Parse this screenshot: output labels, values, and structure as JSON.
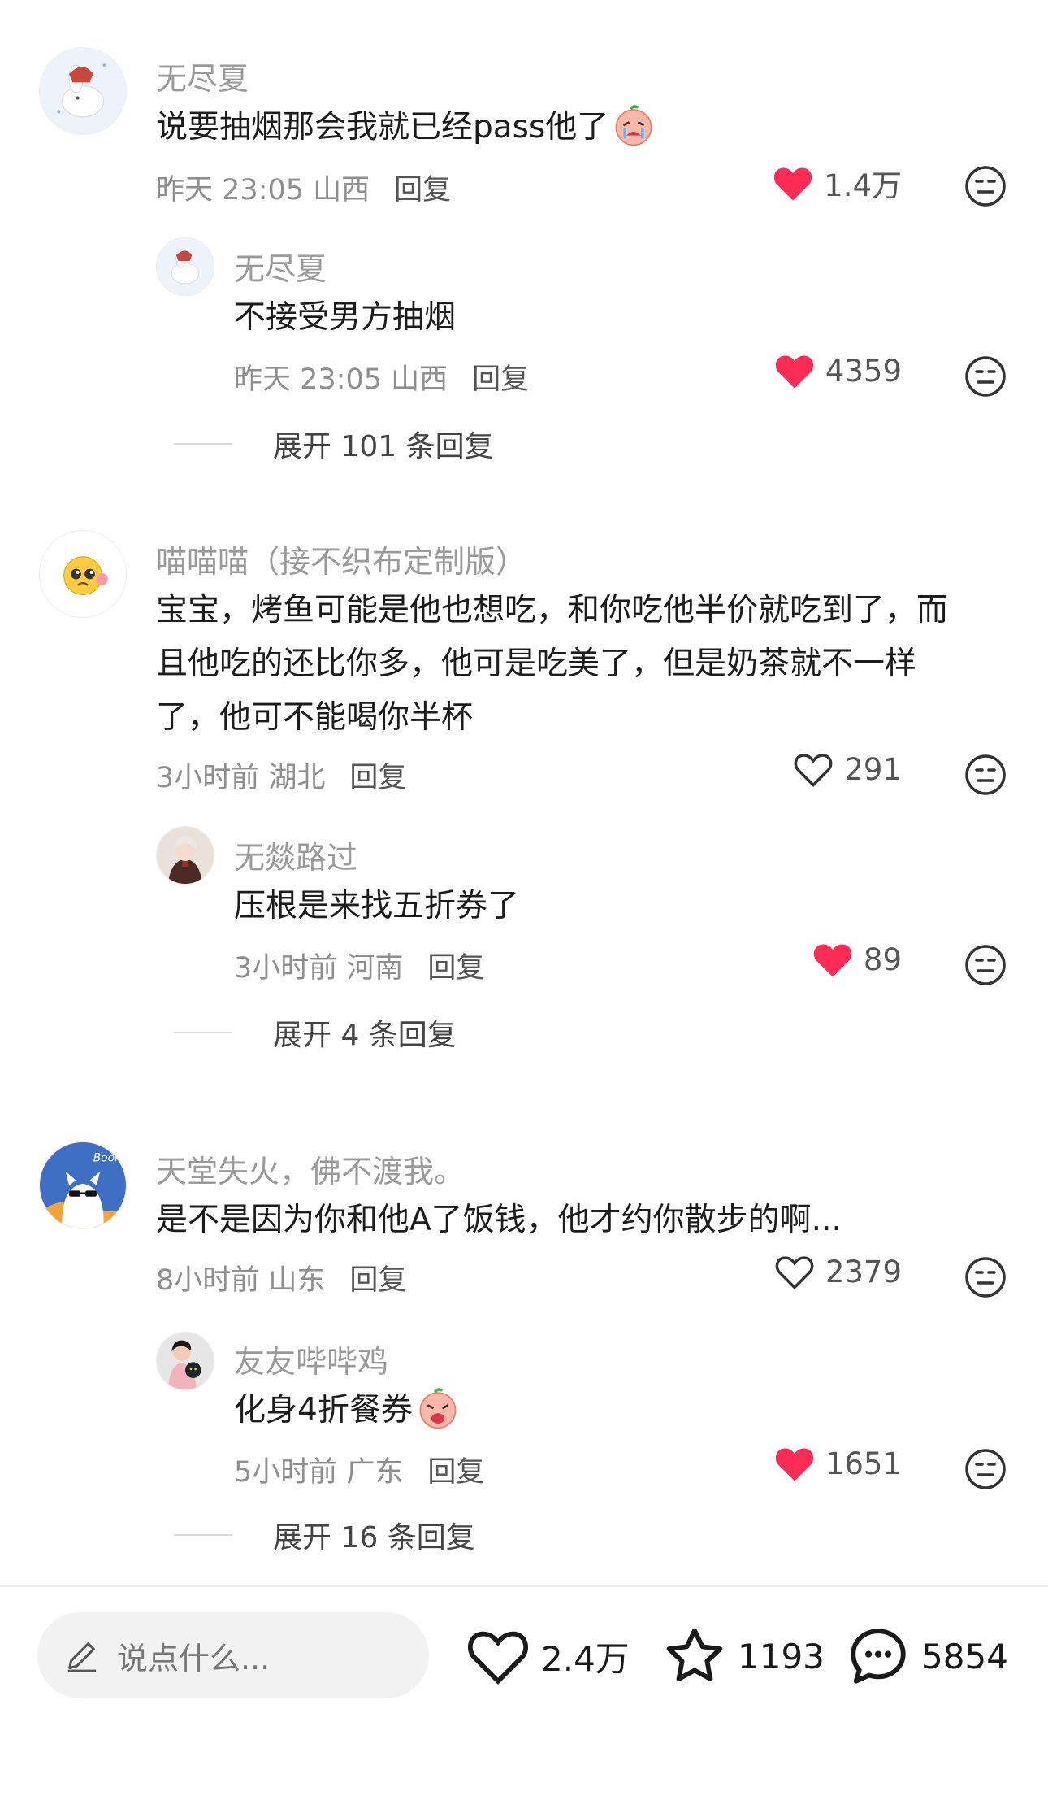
{
  "comments": [
    {
      "user": "无尽夏",
      "text": "说要抽烟那会我就已经pass他了",
      "time": "昨天 23:05 山西",
      "reply_label": "回复",
      "likes": "1.4万",
      "liked": true,
      "reply": {
        "user": "无尽夏",
        "text": "不接受男方抽烟",
        "time": "昨天 23:05 山西",
        "reply_label": "回复",
        "likes": "4359",
        "liked": true
      },
      "expand_label": "展开 101 条回复"
    },
    {
      "user": "喵喵喵（接不织布定制版）",
      "text_lines": [
        "宝宝，烤鱼可能是他也想吃，和你吃他半价就吃到了，而",
        "且他吃的还比你多，他可是吃美了，但是奶茶就不一样",
        "了，他可不能喝你半杯"
      ],
      "time": "3小时前 湖北",
      "reply_label": "回复",
      "likes": "291",
      "liked": false,
      "reply": {
        "user": "无燚路过",
        "text": "压根是来找五折券了",
        "time": "3小时前 河南",
        "reply_label": "回复",
        "likes": "89",
        "liked": true
      },
      "expand_label": "展开 4 条回复"
    },
    {
      "user": "天堂失火，佛不渡我。",
      "text": "是不是因为你和他A了饭钱，他才约你散步的啊...",
      "time": "8小时前 山东",
      "reply_label": "回复",
      "likes": "2379",
      "liked": false,
      "avatar_text": "Boom!",
      "reply": {
        "user": "友友哔哔鸡",
        "text": "化身4折餐券",
        "time": "5小时前 广东",
        "reply_label": "回复",
        "likes": "1651",
        "liked": true
      },
      "expand_label": "展开 16 条回复"
    }
  ],
  "bottom_bar": {
    "input_placeholder": "说点什么...",
    "likes": "2.4万",
    "stars": "1193",
    "comments": "5854"
  },
  "colors": {
    "heart_red": "#fe2c55",
    "muted": "#9a9a9a"
  },
  "icons": [
    "heart-icon",
    "star-icon",
    "chat-icon",
    "pencil-icon",
    "emoji-face-icon"
  ]
}
